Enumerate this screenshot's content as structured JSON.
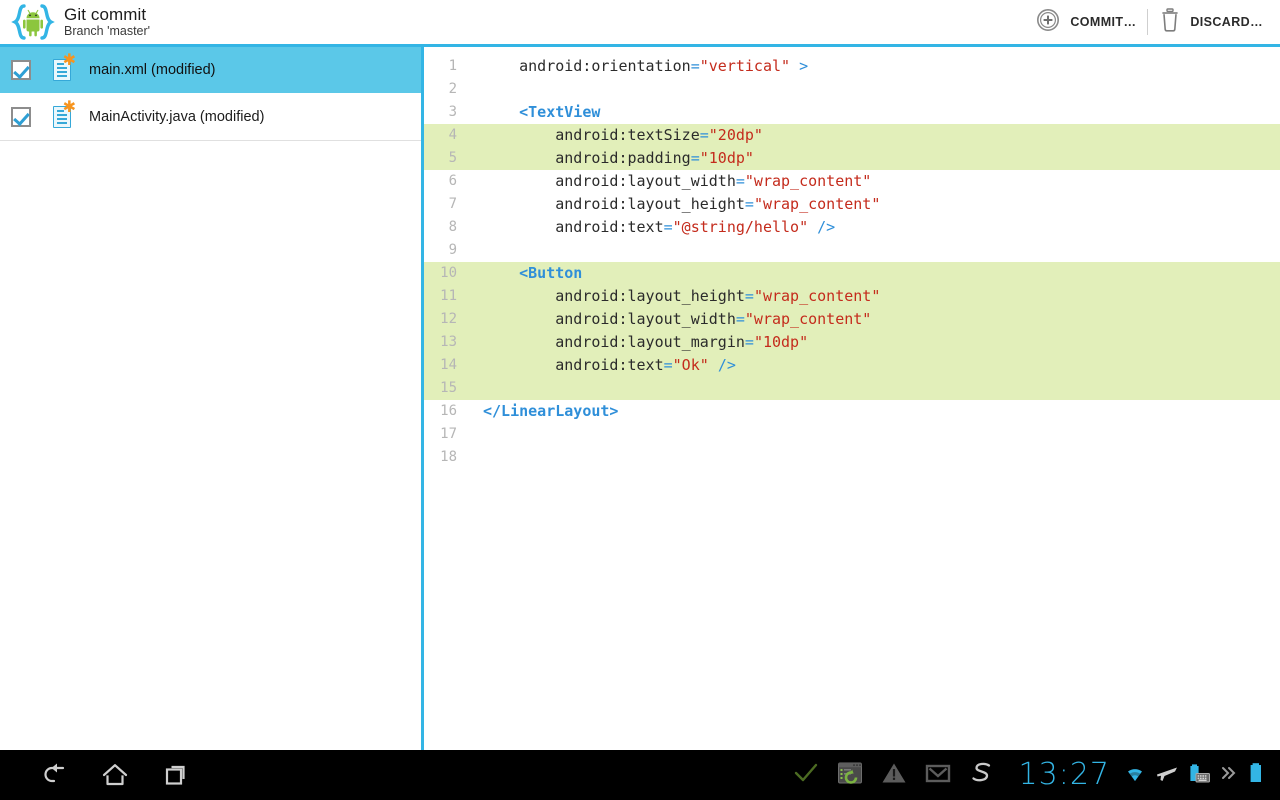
{
  "actionbar": {
    "app_icon": "android-braces-icon",
    "title": "Git commit",
    "subtitle": "Branch 'master'",
    "actions": [
      {
        "icon": "circle-plus-icon",
        "label": "COMMIT…"
      },
      {
        "icon": "trash-icon",
        "label": "DISCARD…"
      }
    ],
    "accent_color": "#33b5e5"
  },
  "sidebar": {
    "files": [
      {
        "name": "main.xml (modified)",
        "checked": true,
        "selected": true,
        "icon": "modified-file-icon",
        "badge": "asterisk-badge-icon"
      },
      {
        "name": "MainActivity.java (modified)",
        "checked": true,
        "selected": false,
        "icon": "modified-file-icon",
        "badge": "asterisk-badge-icon"
      }
    ],
    "selected_color": "#5bc8e8"
  },
  "editor": {
    "diff_highlight_color": "#e2efba",
    "gutter_color": "#b6b6b6",
    "lines": [
      {
        "n": "1",
        "hl": false,
        "tokens": [
          {
            "t": "plain",
            "v": "    android:orientation"
          },
          {
            "t": "eq",
            "v": "="
          },
          {
            "t": "str",
            "v": "\"vertical\""
          },
          {
            "t": "plain",
            "v": " "
          },
          {
            "t": "punc",
            "v": ">"
          }
        ]
      },
      {
        "n": "2",
        "hl": false,
        "tokens": []
      },
      {
        "n": "3",
        "hl": false,
        "tokens": [
          {
            "t": "tag",
            "v": "    <TextView"
          }
        ]
      },
      {
        "n": "4",
        "hl": true,
        "tokens": [
          {
            "t": "plain",
            "v": "        android:textSize"
          },
          {
            "t": "eq",
            "v": "="
          },
          {
            "t": "str",
            "v": "\"20dp\""
          }
        ]
      },
      {
        "n": "5",
        "hl": true,
        "tokens": [
          {
            "t": "plain",
            "v": "        android:padding"
          },
          {
            "t": "eq",
            "v": "="
          },
          {
            "t": "str",
            "v": "\"10dp\""
          }
        ]
      },
      {
        "n": "6",
        "hl": false,
        "tokens": [
          {
            "t": "plain",
            "v": "        android:layout_width"
          },
          {
            "t": "eq",
            "v": "="
          },
          {
            "t": "str",
            "v": "\"wrap_content\""
          }
        ]
      },
      {
        "n": "7",
        "hl": false,
        "tokens": [
          {
            "t": "plain",
            "v": "        android:layout_height"
          },
          {
            "t": "eq",
            "v": "="
          },
          {
            "t": "str",
            "v": "\"wrap_content\""
          }
        ]
      },
      {
        "n": "8",
        "hl": false,
        "tokens": [
          {
            "t": "plain",
            "v": "        android:text"
          },
          {
            "t": "eq",
            "v": "="
          },
          {
            "t": "str",
            "v": "\"@string/hello\""
          },
          {
            "t": "plain",
            "v": " "
          },
          {
            "t": "punc",
            "v": "/>"
          }
        ]
      },
      {
        "n": "9",
        "hl": false,
        "tokens": []
      },
      {
        "n": "10",
        "hl": true,
        "tokens": [
          {
            "t": "tag",
            "v": "    <Button"
          }
        ]
      },
      {
        "n": "11",
        "hl": true,
        "tokens": [
          {
            "t": "plain",
            "v": "        android:layout_height"
          },
          {
            "t": "eq",
            "v": "="
          },
          {
            "t": "str",
            "v": "\"wrap_content\""
          }
        ]
      },
      {
        "n": "12",
        "hl": true,
        "tokens": [
          {
            "t": "plain",
            "v": "        android:layout_width"
          },
          {
            "t": "eq",
            "v": "="
          },
          {
            "t": "str",
            "v": "\"wrap_content\""
          }
        ]
      },
      {
        "n": "13",
        "hl": true,
        "tokens": [
          {
            "t": "plain",
            "v": "        android:layout_margin"
          },
          {
            "t": "eq",
            "v": "="
          },
          {
            "t": "str",
            "v": "\"10dp\""
          }
        ]
      },
      {
        "n": "14",
        "hl": true,
        "tokens": [
          {
            "t": "plain",
            "v": "        android:text"
          },
          {
            "t": "eq",
            "v": "="
          },
          {
            "t": "str",
            "v": "\"Ok\""
          },
          {
            "t": "plain",
            "v": " "
          },
          {
            "t": "punc",
            "v": "/>"
          }
        ]
      },
      {
        "n": "15",
        "hl": true,
        "tokens": []
      },
      {
        "n": "16",
        "hl": false,
        "tokens": [
          {
            "t": "tag",
            "v": "</LinearLayout>"
          }
        ]
      },
      {
        "n": "17",
        "hl": false,
        "tokens": []
      },
      {
        "n": "18",
        "hl": false,
        "tokens": []
      }
    ]
  },
  "systembar": {
    "nav": [
      {
        "name": "back-icon"
      },
      {
        "name": "home-icon"
      },
      {
        "name": "recent-apps-icon"
      }
    ],
    "notifications": [
      {
        "name": "checkmark-icon"
      },
      {
        "name": "sync-update-icon"
      },
      {
        "name": "warning-icon"
      },
      {
        "name": "gmail-icon"
      },
      {
        "name": "skype-s-icon"
      }
    ],
    "clock": "13:27",
    "status": [
      {
        "name": "wifi-icon"
      },
      {
        "name": "airplane-mode-icon"
      },
      {
        "name": "keyboard-battery-icon"
      },
      {
        "name": "more-chevron-icon"
      },
      {
        "name": "battery-icon"
      }
    ],
    "clock_color": "#33b5e5"
  }
}
